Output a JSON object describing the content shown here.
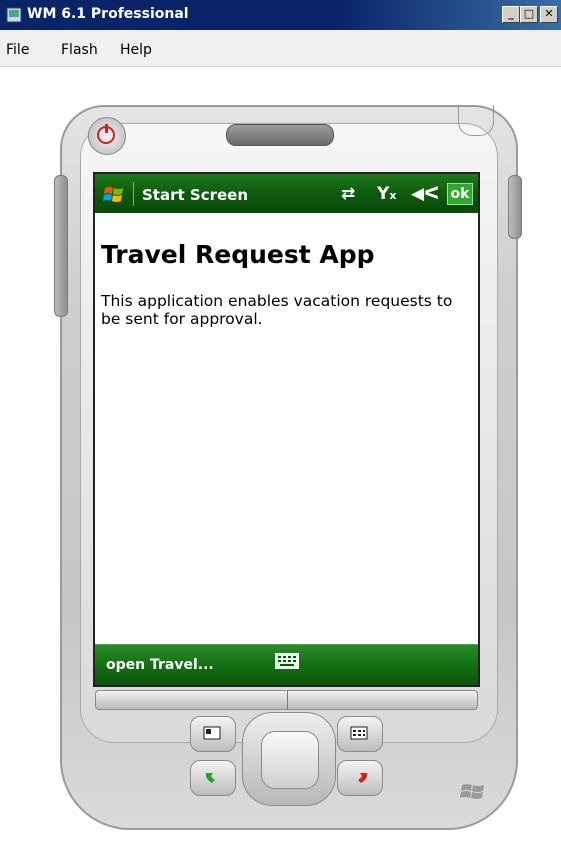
{
  "window": {
    "title": "WM 6.1 Professional"
  },
  "menu": {
    "items": [
      "File",
      "Flash",
      "Help"
    ]
  },
  "device": {
    "top_bar_title": "Start Screen",
    "ok_label": "ok",
    "app_title": "Travel Request App",
    "app_description": "This application enables vacation requests to be sent for approval.",
    "left_softkey": "open Travel..."
  },
  "colors": {
    "wm_green": "#0e5a0e",
    "accent_green": "#2fa82f",
    "title_blue": "#0a246a"
  },
  "icons": [
    "app-icon",
    "minimize-icon",
    "maximize-icon",
    "close-icon",
    "power-icon",
    "start-flag-icon",
    "connectivity-icon",
    "signal-off-icon",
    "speaker-mute-icon",
    "keyboard-icon",
    "windows-logo-icon"
  ]
}
